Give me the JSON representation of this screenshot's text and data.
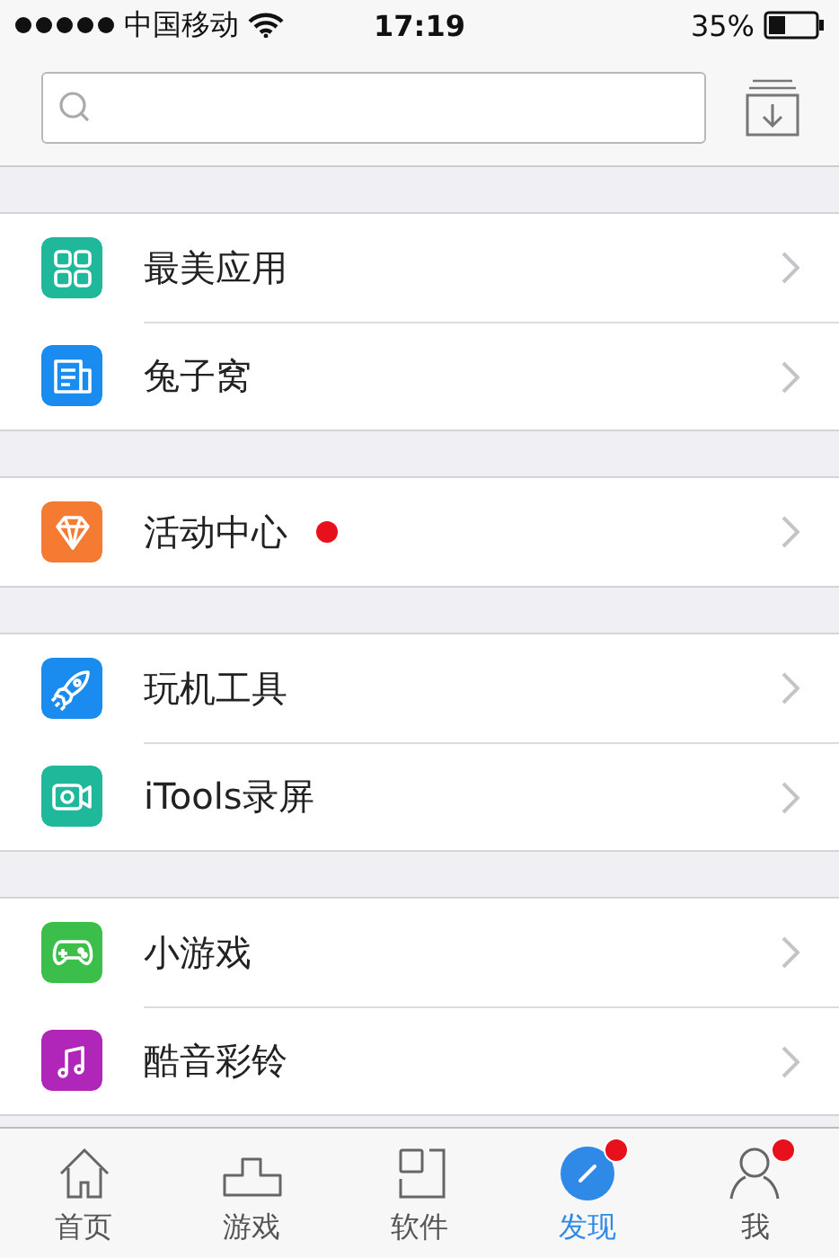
{
  "status_bar": {
    "carrier": "中国移动",
    "time": "17:19",
    "battery": "35%"
  },
  "groups": [
    {
      "items": [
        {
          "label": "最美应用",
          "color": "#1fb89a",
          "badge": false
        },
        {
          "label": "兔子窝",
          "color": "#1a8cf0",
          "badge": false
        }
      ]
    },
    {
      "items": [
        {
          "label": "活动中心",
          "color": "#f57a32",
          "badge": true
        }
      ]
    },
    {
      "items": [
        {
          "label": "玩机工具",
          "color": "#1a8cf0",
          "badge": false
        },
        {
          "label": "iTools录屏",
          "color": "#1fb89a",
          "badge": false
        }
      ]
    },
    {
      "items": [
        {
          "label": "小游戏",
          "color": "#3cbf4a",
          "badge": false
        },
        {
          "label": "酷音彩铃",
          "color": "#b026b8",
          "badge": false
        }
      ]
    }
  ],
  "tabs": [
    {
      "label": "首页",
      "selected": false,
      "badge": false
    },
    {
      "label": "游戏",
      "selected": false,
      "badge": false
    },
    {
      "label": "软件",
      "selected": false,
      "badge": false
    },
    {
      "label": "发现",
      "selected": true,
      "badge": true
    },
    {
      "label": "我",
      "selected": false,
      "badge": true
    }
  ]
}
